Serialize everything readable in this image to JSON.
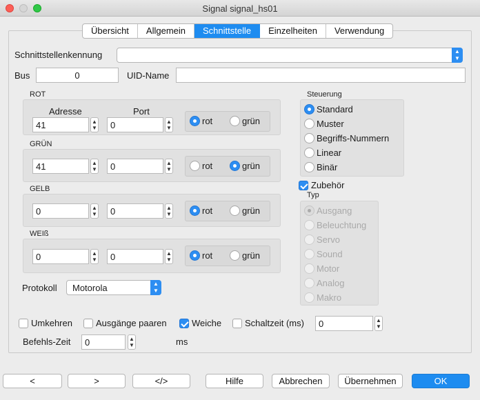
{
  "window": {
    "title": "Signal signal_hs01"
  },
  "tabs": [
    {
      "label": "Übersicht"
    },
    {
      "label": "Allgemein"
    },
    {
      "label": "Schnittstelle",
      "active": true
    },
    {
      "label": "Einzelheiten"
    },
    {
      "label": "Verwendung"
    }
  ],
  "interface": {
    "id_label": "Schnittstellenkennung",
    "id_value": "",
    "bus_label": "Bus",
    "bus_value": "0",
    "uid_label": "UID-Name",
    "uid_value": ""
  },
  "columns": {
    "address": "Adresse",
    "port": "Port"
  },
  "outputs": [
    {
      "label": "ROT",
      "address": "41",
      "port": "0",
      "rot": "rot",
      "gruen": "grün",
      "selected": "rot"
    },
    {
      "label": "GRÜN",
      "address": "41",
      "port": "0",
      "rot": "rot",
      "gruen": "grün",
      "selected": "grün"
    },
    {
      "label": "GELB",
      "address": "0",
      "port": "0",
      "rot": "rot",
      "gruen": "grün",
      "selected": "rot"
    },
    {
      "label": "WEIß",
      "address": "0",
      "port": "0",
      "rot": "rot",
      "gruen": "grün",
      "selected": "rot"
    }
  ],
  "steuerung": {
    "label": "Steuerung",
    "options": [
      "Standard",
      "Muster",
      "Begriffs-Nummern",
      "Linear",
      "Binär"
    ],
    "selected": "Standard"
  },
  "zubehoer": {
    "label": "Zubehör",
    "checked": true,
    "typ_label": "Typ",
    "types": [
      "Ausgang",
      "Beleuchtung",
      "Servo",
      "Sound",
      "Motor",
      "Analog",
      "Makro"
    ],
    "selected": "Ausgang",
    "enabled": false
  },
  "protokoll": {
    "label": "Protokoll",
    "value": "Motorola"
  },
  "options": {
    "umkehren": "Umkehren",
    "ausgaenge_paaren": "Ausgänge paaren",
    "weiche": "Weiche",
    "schaltzeit": "Schaltzeit (ms)",
    "schaltzeit_value": "0",
    "umkehren_checked": false,
    "ausgaenge_checked": false,
    "weiche_checked": true,
    "schaltzeit_checked": false
  },
  "befehls_zeit": {
    "label": "Befehls-Zeit",
    "value": "0",
    "unit": "ms"
  },
  "footer": {
    "prev": "<",
    "next": ">",
    "code": "</>",
    "help": "Hilfe",
    "cancel": "Abbrechen",
    "apply": "Übernehmen",
    "ok": "OK"
  },
  "colors": {
    "accent": "#1e8cf0",
    "close": "#fc5f57",
    "max": "#30c748"
  }
}
